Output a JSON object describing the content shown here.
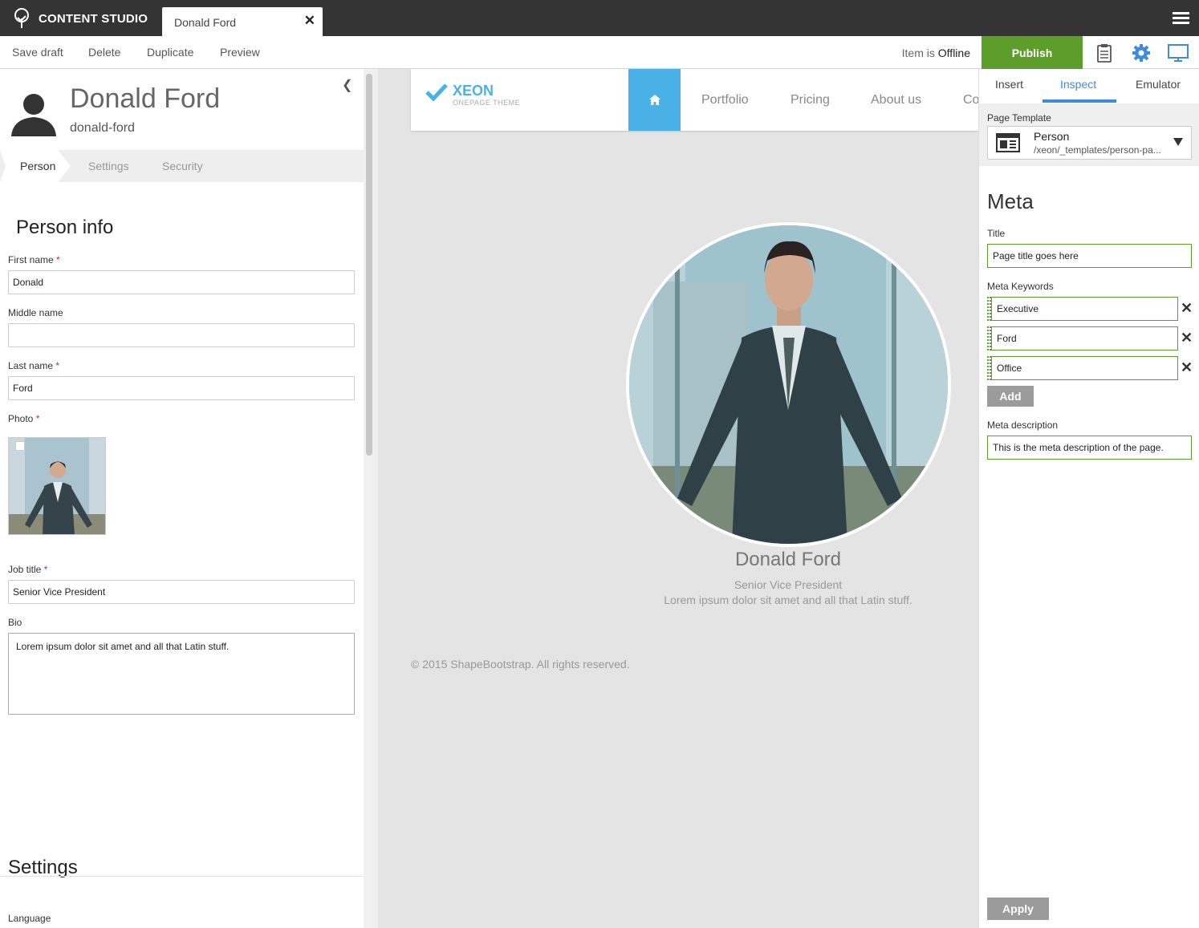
{
  "app": {
    "name": "CONTENT STUDIO",
    "tab_title": "Donald Ford",
    "tab_close": "✕"
  },
  "toolbar": {
    "save_draft": "Save draft",
    "delete": "Delete",
    "duplicate": "Duplicate",
    "preview": "Preview",
    "status_prefix": "Item is",
    "status_value": "Offline",
    "publish": "Publish"
  },
  "content": {
    "display_name": "Donald Ford",
    "path": "donald-ford",
    "tabs": [
      "Person",
      "Settings",
      "Security"
    ]
  },
  "form": {
    "section_title": "Person info",
    "first_name_label": "First name",
    "first_name_value": "Donald",
    "middle_name_label": "Middle name",
    "middle_name_value": "",
    "last_name_label": "Last name",
    "last_name_value": "Ford",
    "photo_label": "Photo",
    "job_title_label": "Job title",
    "job_title_value": "Senior Vice President",
    "bio_label": "Bio",
    "bio_value": "Lorem ipsum dolor sit amet and all that Latin stuff.",
    "required_mark": "*",
    "settings_title": "Settings",
    "language_label": "Language"
  },
  "preview_site": {
    "logo_name": "XEON",
    "logo_sub": "ONEPAGE THEME",
    "nav": [
      "Portfolio",
      "Pricing",
      "About us",
      "Co"
    ],
    "person_name": "Donald Ford",
    "person_title": "Senior Vice President",
    "person_bio": "Lorem ipsum dolor sit amet and all that Latin stuff.",
    "footer": "© 2015 ShapeBootstrap. All rights reserved."
  },
  "inspect_panel": {
    "tabs": [
      "Insert",
      "Inspect",
      "Emulator"
    ],
    "active_tab": "Inspect",
    "page_template_label": "Page Template",
    "template_name": "Person",
    "template_path": "/xeon/_templates/person-pa...",
    "meta_heading": "Meta",
    "title_label": "Title",
    "title_value": "Page title goes here",
    "keywords_label": "Meta Keywords",
    "keywords": [
      "Executive",
      "Ford",
      "Office"
    ],
    "remove_mark": "✕",
    "add_label": "Add",
    "description_label": "Meta description",
    "description_value": "This is the meta description of the page.",
    "apply_label": "Apply"
  },
  "colors": {
    "appbar": "#343434",
    "publish": "#5d9e2b",
    "accent_blue": "#3f8ae0",
    "site_blue": "#4ab1e6",
    "required": "#c8293b"
  }
}
